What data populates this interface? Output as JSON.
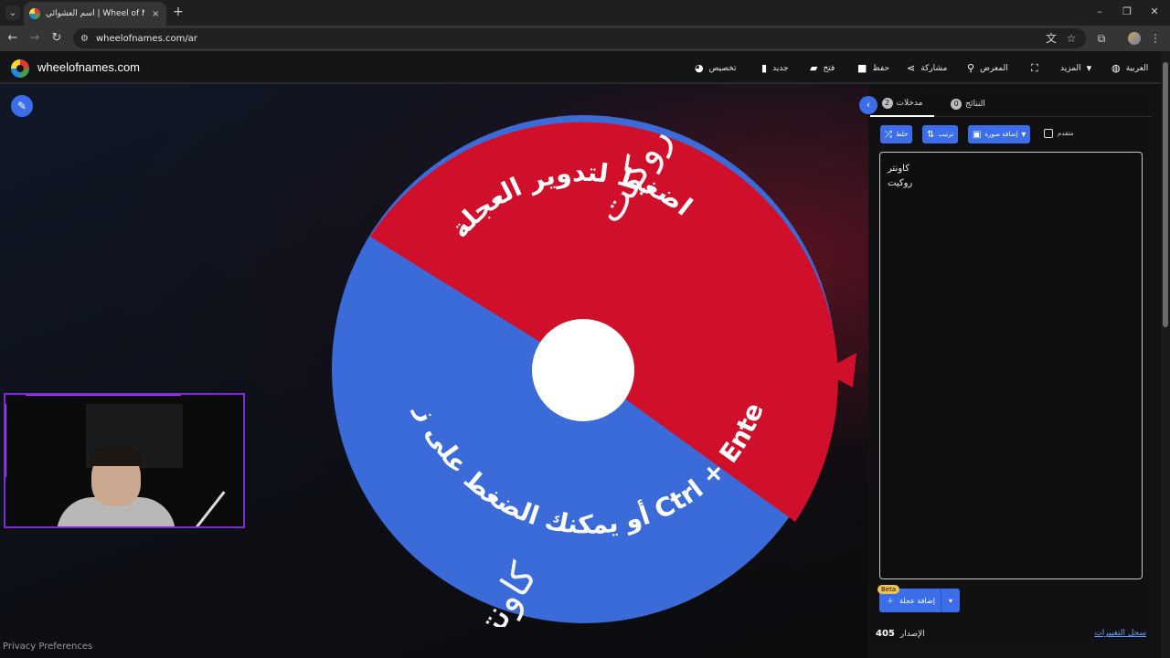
{
  "browser": {
    "tab_title": "اسم العشوائي | Wheel of Names",
    "url": "wheelofnames.com/ar",
    "new_tab_glyph": "+",
    "close_glyph": "×"
  },
  "header": {
    "logo_text": "wheelofnames.com",
    "menu": {
      "customize": "تخصيص",
      "new": "جديد",
      "open": "فتح",
      "save": "حفظ",
      "share": "مشاركة",
      "gallery": "المعرض",
      "more": "المزيد",
      "language": "العربية"
    }
  },
  "wheel": {
    "segments": [
      {
        "label": "روكيت",
        "color": "#d0102a"
      },
      {
        "label": "كاونتر",
        "color": "#3b6bd8"
      }
    ],
    "instruction_top": "اضغط لتدوير العجلة",
    "instruction_bottom": "أو يمكنك الضغط على زر Ctrl + Enter",
    "pointer_color": "#d0102a"
  },
  "footer": {
    "privacy": "Privacy Preferences"
  },
  "panel": {
    "tabs": {
      "entries_label": "مدخلات",
      "entries_count": "2",
      "results_label": "النتائج",
      "results_count": "0"
    },
    "toolbar": {
      "shuffle": "خلط",
      "sort": "ترتيب",
      "add_image": "إضافة صورة",
      "advanced": "متقدم"
    },
    "entries": [
      "كاونتر",
      "روكيت"
    ],
    "add_wheel": "إضافة عجلة",
    "beta": "Beta",
    "version_label": "الإصدار",
    "version_number": "405",
    "changelog": "سجل التغييرات"
  },
  "colors": {
    "accent": "#3b6ee8",
    "red_segment": "#d0102a",
    "blue_segment": "#3b6bd8"
  }
}
